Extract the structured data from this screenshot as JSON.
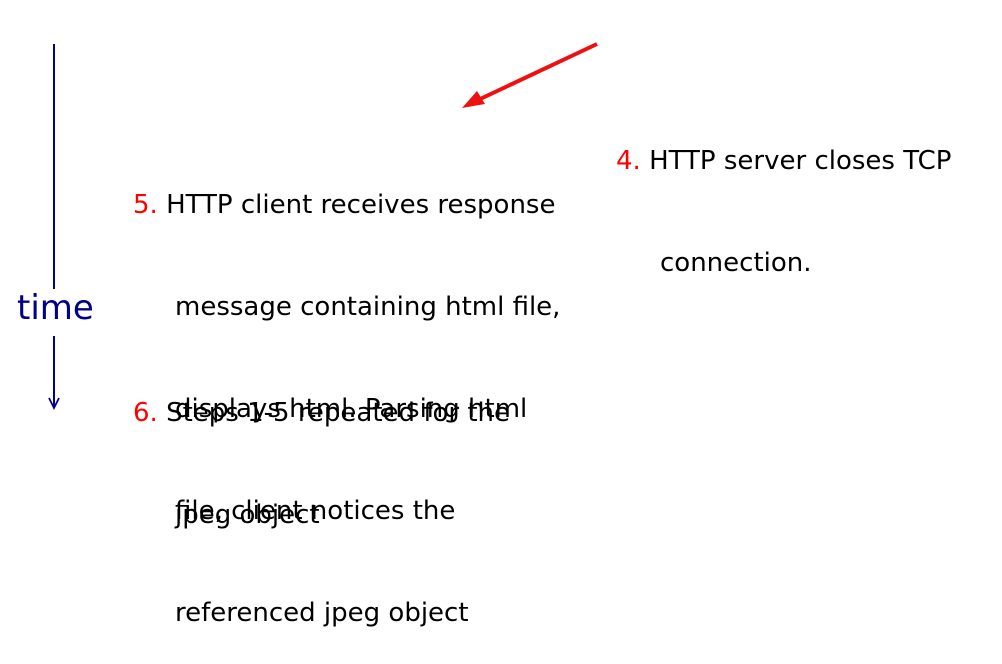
{
  "timeline": {
    "label": "time",
    "color": "#00008b"
  },
  "arrow": {
    "color": "#ee1111"
  },
  "steps": {
    "step4": {
      "number": "4.",
      "lines": [
        "HTTP server closes TCP",
        "connection."
      ]
    },
    "step5": {
      "number": "5.",
      "lines": [
        "HTTP client receives response",
        "message containing html file,",
        "displays html. Parsing html",
        "file, client notices the",
        "referenced jpeg object"
      ]
    },
    "step6": {
      "number": "6.",
      "lines": [
        "Steps 1-5 repeated for the",
        "jpeg object"
      ]
    }
  },
  "colors": {
    "step_number": "#ff0000",
    "text": "#000000"
  }
}
